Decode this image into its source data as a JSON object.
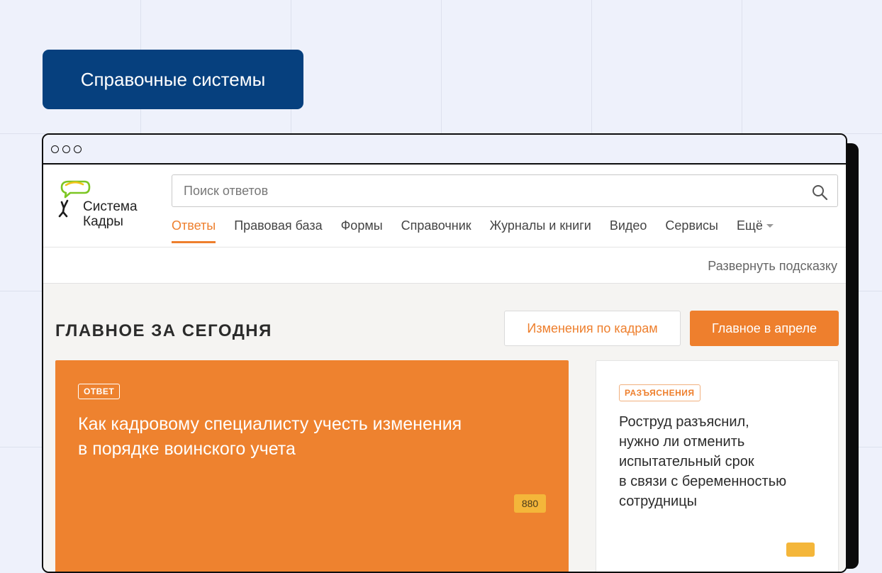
{
  "section_label": "Справочные системы",
  "app": {
    "logo_line1": "Система",
    "logo_line2": "Кадры",
    "search_placeholder": "Поиск ответов",
    "nav": [
      {
        "label": "Ответы",
        "active": true
      },
      {
        "label": "Правовая база"
      },
      {
        "label": "Формы"
      },
      {
        "label": "Справочник"
      },
      {
        "label": "Журналы и книги"
      },
      {
        "label": "Видео"
      },
      {
        "label": "Сервисы"
      },
      {
        "label": "Ещё"
      }
    ],
    "hint_link": "Развернуть подсказку"
  },
  "main": {
    "title": "ГЛАВНОЕ ЗА СЕГОДНЯ",
    "btn_changes": "Изменения по кадрам",
    "btn_april": "Главное в апреле",
    "card_main": {
      "tag": "ОТВЕТ",
      "title_line1": "Как кадровому специалисту учесть изменения",
      "title_line2": "в порядке воинского учета",
      "count": "880"
    },
    "card_side": {
      "tag": "РАЗЪЯСНЕНИЯ",
      "lines": [
        "Роструд разъяснил,",
        "нужно ли отменить",
        "испытательный срок",
        "в связи с беременностью",
        "сотрудницы"
      ]
    }
  },
  "colors": {
    "accent_orange": "#ee7f2d",
    "label_navy": "#06407e",
    "badge_yellow": "#f4b63a"
  }
}
